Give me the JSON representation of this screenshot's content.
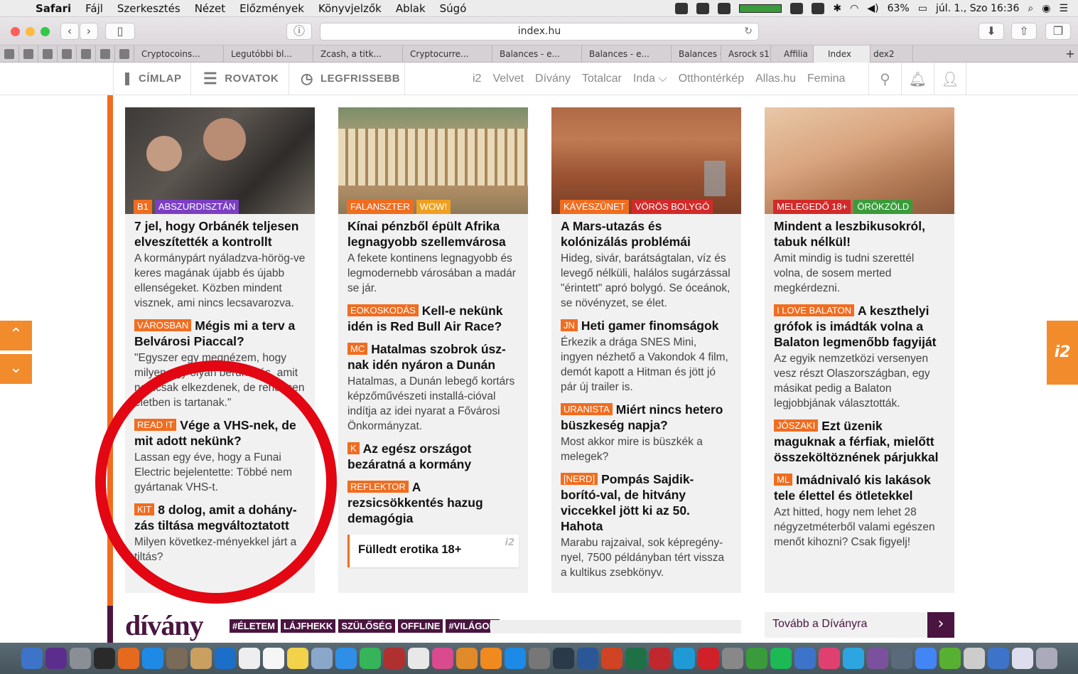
{
  "menubar": {
    "app": "Safari",
    "items": [
      "Fájl",
      "Szerkesztés",
      "Nézet",
      "Előzmények",
      "Könyvjelzők",
      "Ablak",
      "Súgó"
    ],
    "battery": "63%",
    "datetime": "júl. 1., Szo  16:36"
  },
  "browser": {
    "url": "index.hu",
    "tabs": [
      "Cryptocoins...",
      "Legutóbbi bl...",
      "Zcash, a titk...",
      "Cryptocurre...",
      "Balances - e...",
      "Balances - e...",
      "Balances - e...",
      "Asrock s1",
      "Affilia",
      "Index",
      "dex2"
    ]
  },
  "sitenav": {
    "cimlap": "CÍMLAP",
    "rovatok": "ROVATOK",
    "legfrissebb": "LEGFRISSEBB",
    "links": [
      "i2",
      "Velvet",
      "Dívány",
      "Totalcar",
      "Inda ⌵",
      "Otthontérkép",
      "Allas.hu",
      "Femina"
    ]
  },
  "side": {
    "i2": "i2",
    "up": "⌃",
    "down": "⌄"
  },
  "columns": [
    {
      "tags": [
        {
          "text": "B1",
          "color": "#f06d20"
        },
        {
          "text": "ABSZURDISZTÁN",
          "color": "#7b3fc4"
        }
      ],
      "title": "7 jel, hogy Orbánék teljesen elveszítették a kontrollt",
      "lead": "A kormánypárt nyáladzva-hörög-ve keres magának újabb és újabb ellenségeket. Közben mindent visznek, ami nincs lecsavarozva.",
      "articles": [
        {
          "label": "VÁROSBAN",
          "title": "Mégis mi a terv a Belvárosi Piaccal?",
          "text": "\"Egyszer egy megnézem, hogy milyen egy olyan beruházás, amit nemcsak elkezdenek, de rendesen életben is tartanak.\""
        },
        {
          "label": "READ !T",
          "title": "Vége a VHS-nek, de mit adott nekünk?",
          "text": "Lassan egy éve, hogy a Funai Electric bejelentette: Többé nem gyártanak VHS-t."
        },
        {
          "label": "KIT",
          "title": "8 dolog, amit a dohány-zás tiltása megváltoztatott",
          "text": "Milyen következ-ményekkel járt a tiltás?"
        }
      ]
    },
    {
      "tags": [
        {
          "text": "FALANSZTER",
          "color": "#f06d20"
        },
        {
          "text": "WOW!",
          "color": "#f0a020"
        }
      ],
      "title": "Kínai pénzből épült Afrika legnagyobb szellemvárosa",
      "lead": "A fekete kontinens legnagyobb és legmodernebb városában a madár se jár.",
      "articles": [
        {
          "label": "EOKOSKODÁS",
          "title": "Kell-e nekünk idén is Red Bull Air Race?",
          "text": ""
        },
        {
          "label": "MC",
          "title": "Hatalmas szobrok úsz-nak idén nyáron a Dunán",
          "text": "Hatalmas, a Dunán lebegő kortárs képzőművészeti installá-cióval indítja az idei nyarat a Fővárosi Önkormányzat."
        },
        {
          "label": "K",
          "title": "Az egész országot bezáratná a kormány",
          "text": ""
        },
        {
          "label": "REFLEKTOR",
          "title": "A rezsicsökkentés hazug demagógia",
          "text": ""
        }
      ],
      "promo": {
        "text": "Fülledt erotika 18+",
        "badge": "i2"
      }
    },
    {
      "tags": [
        {
          "text": "KÁVÉSZÜNET",
          "color": "#f06d20"
        },
        {
          "text": "VÖRÖS BOLYGÓ",
          "color": "#d22a2a"
        }
      ],
      "title": "A Mars-utazás és kolónizálás problémái",
      "lead": "Hideg, sivár, barátságtalan, víz és levegő nélküli, halálos sugárzással \"érintett\" apró bolygó. Se óceánok, se növényzet, se élet.",
      "articles": [
        {
          "label": "JN",
          "title": "Heti gamer finomságok",
          "text": "Érkezik a drága SNES Mini, ingyen nézhető a Vakondok 4 film, demót kapott a Hitman és jött jó pár új trailer is."
        },
        {
          "label": "URANISTA",
          "title": "Miért nincs hetero büszkeség napja?",
          "text": "Most akkor mire is büszkék a melegek?"
        },
        {
          "label": "[NERD]",
          "title": "Pompás Sajdik-borító-val, de hitvány viccekkel jött ki az 50. Hahota",
          "text": "Marabu rajzaival, sok képregény-nyel, 7500 példányban tért vissza a kultikus zsebkönyv."
        }
      ]
    },
    {
      "tags": [
        {
          "text": "MELEGEDŐ 18+",
          "color": "#d22a2a"
        },
        {
          "text": "ÖRÖKZÖLD",
          "color": "#3a9b3a"
        }
      ],
      "title": "Mindent a leszbikusokról, tabuk nélkül!",
      "lead": "Amit mindig is tudni szerettél volna, de sosem merted megkérdezni.",
      "articles": [
        {
          "label": "I LOVE BALATON",
          "title": "A keszthelyi grófok is imádták volna a Balaton legmenőbb fagyiját",
          "text": "Az egyik nemzetközi versenyen vesz részt Olaszországban, egy másikat pedig a Balaton legjobbjának választották."
        },
        {
          "label": "JÓSZAKI",
          "title": "Ezt üzenik maguknak a férfiak, mielőtt összeköltöznének párjukkal",
          "text": ""
        },
        {
          "label": "ML",
          "title": "Imádnivaló kis lakások tele élettel és ötletekkel",
          "text": "Azt hitted, hogy nem lehet 28 négyzetméterből valami egészen menőt kihozni? Csak figyelj!"
        }
      ]
    }
  ],
  "divany": {
    "logo": "dívány",
    "tags": [
      "#ÉLETEM",
      "LÁJFHEKK",
      "SZÜLŐSÉG",
      "OFFLINE",
      "#VILÁGOM"
    ],
    "more": "Tovább a Dívány­ra",
    "arrow": "›"
  }
}
